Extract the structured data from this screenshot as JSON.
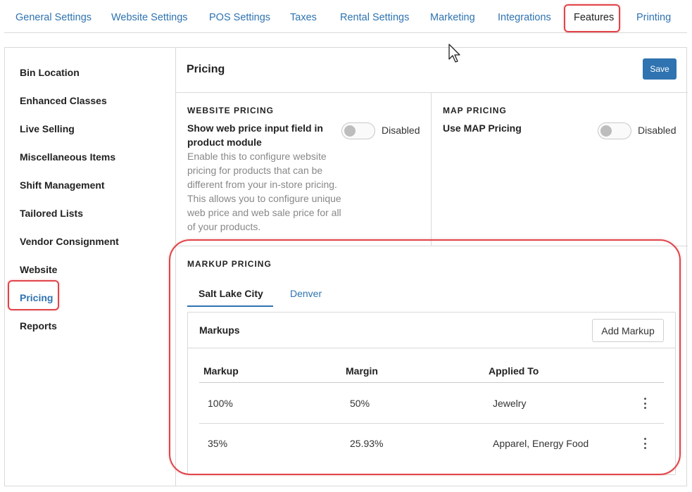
{
  "top_tabs": [
    {
      "label": "General Settings"
    },
    {
      "label": "Website Settings"
    },
    {
      "label": "POS Settings"
    },
    {
      "label": "Taxes"
    },
    {
      "label": "Rental Settings"
    },
    {
      "label": "Marketing"
    },
    {
      "label": "Integrations"
    },
    {
      "label": "Features",
      "active": true
    },
    {
      "label": "Printing"
    }
  ],
  "sidebar": {
    "items": [
      {
        "label": "Bin Location"
      },
      {
        "label": "Enhanced Classes"
      },
      {
        "label": "Live Selling"
      },
      {
        "label": "Miscellaneous Items"
      },
      {
        "label": "Shift Management"
      },
      {
        "label": "Tailored Lists"
      },
      {
        "label": "Vendor Consignment"
      },
      {
        "label": "Website"
      },
      {
        "label": "Pricing",
        "active": true
      },
      {
        "label": "Reports"
      }
    ]
  },
  "content": {
    "title": "Pricing",
    "save_label": "Save",
    "website_pricing": {
      "heading": "WEBSITE PRICING",
      "field_label": "Show web price input field in product module",
      "description": "Enable this to configure website pricing for products that can be different from your in-store pricing. This allows you to configure unique web price and web sale price for all of your products.",
      "toggle_label": "Disabled",
      "enabled": false
    },
    "map_pricing": {
      "heading": "MAP PRICING",
      "field_label": "Use MAP Pricing",
      "toggle_label": "Disabled",
      "enabled": false
    },
    "markup_pricing": {
      "heading": "MARKUP PRICING",
      "tabs": [
        {
          "label": "Salt Lake City",
          "active": true
        },
        {
          "label": "Denver"
        }
      ],
      "card_title": "Markups",
      "add_label": "Add Markup",
      "columns": [
        "Markup",
        "Margin",
        "Applied To"
      ],
      "rows": [
        {
          "markup": "100%",
          "margin": "50%",
          "applied_to": "Jewelry"
        },
        {
          "markup": "35%",
          "margin": "25.93%",
          "applied_to": "Apparel, Energy Food"
        }
      ]
    }
  },
  "colors": {
    "accent": "#2f73b0",
    "highlight": "#e0444a"
  }
}
